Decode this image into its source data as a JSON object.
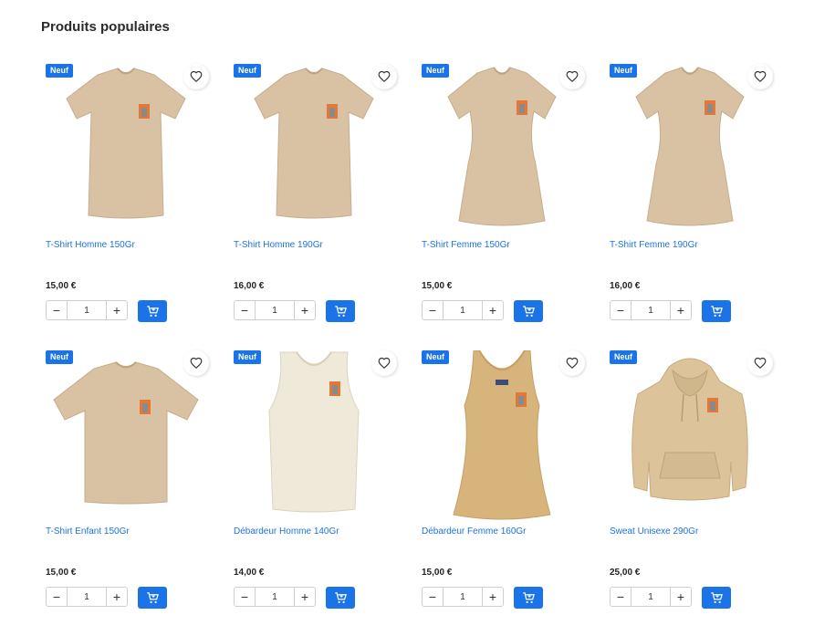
{
  "section": {
    "title": "Produits populaires"
  },
  "colors": {
    "accent": "#1a73e8",
    "sand": "#d8c2a3",
    "natural": "#efe9da",
    "camel": "#d7b47b",
    "hoodie": "#dcc39a"
  },
  "products": [
    {
      "name": "T-Shirt Homme 150Gr",
      "price": "15,00 €",
      "badge": "Neuf",
      "qty": "1",
      "garment": "tshirt-man-icon"
    },
    {
      "name": "T-Shirt Homme 190Gr",
      "price": "16,00 €",
      "badge": "Neuf",
      "qty": "1",
      "garment": "tshirt-man-icon"
    },
    {
      "name": "T-Shirt Femme 150Gr",
      "price": "15,00 €",
      "badge": "Neuf",
      "qty": "1",
      "garment": "tshirt-woman-icon"
    },
    {
      "name": "T-Shirt Femme 190Gr",
      "price": "16,00 €",
      "badge": "Neuf",
      "qty": "1",
      "garment": "tshirt-woman-icon"
    },
    {
      "name": "T-Shirt Enfant 150Gr",
      "price": "15,00 €",
      "badge": "Neuf",
      "qty": "1",
      "garment": "tshirt-kid-icon"
    },
    {
      "name": "Débardeur Homme 140Gr",
      "price": "14,00 €",
      "badge": "Neuf",
      "qty": "1",
      "garment": "tanktop-man-icon"
    },
    {
      "name": "Débardeur Femme 160Gr",
      "price": "15,00 €",
      "badge": "Neuf",
      "qty": "1",
      "garment": "tanktop-woman-icon"
    },
    {
      "name": "Sweat Unisexe 290Gr",
      "price": "25,00 €",
      "badge": "Neuf",
      "qty": "1",
      "garment": "hoodie-icon"
    }
  ]
}
